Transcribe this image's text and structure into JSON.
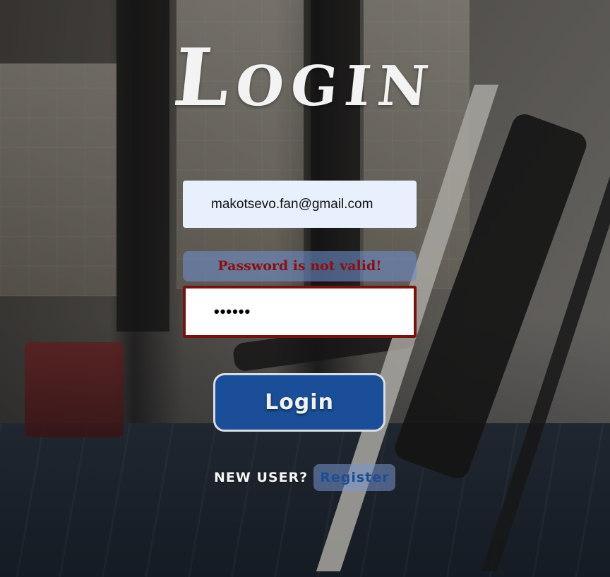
{
  "page": {
    "title": "Login"
  },
  "form": {
    "email_value": "makotsevo.fan@gmail.com",
    "error_message": "Password is not valid!",
    "password_value": "••••••",
    "login_button_label": "Login"
  },
  "footer": {
    "new_user_label": "NEW USER?",
    "register_link_label": "Register"
  },
  "colors": {
    "error_text": "#8b0f0f",
    "error_border": "#7a1010",
    "button_bg": "#1a4e98",
    "email_bg": "#e8f0fe",
    "link_text": "#1c4e96"
  }
}
